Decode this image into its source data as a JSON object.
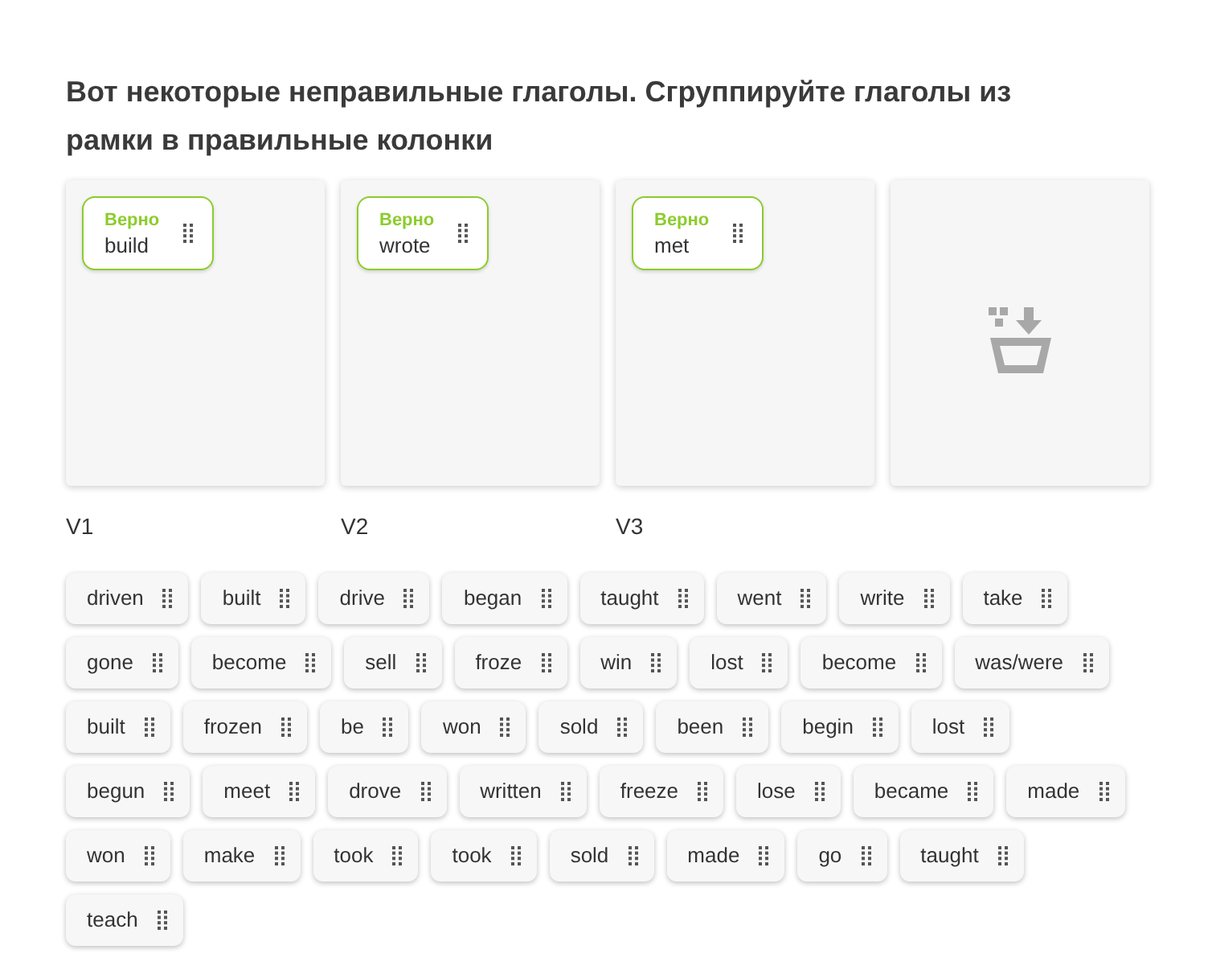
{
  "question": "Вот некоторые неправильные глаголы. Сгруппируйте глаголы из рамки в правильные колонки",
  "columns": [
    {
      "kind": "column",
      "label": "V1",
      "items": [
        {
          "verdict": "Верно",
          "correct": true,
          "word": "build"
        }
      ]
    },
    {
      "kind": "column",
      "label": "V2",
      "items": [
        {
          "verdict": "Верно",
          "correct": true,
          "word": "wrote"
        }
      ]
    },
    {
      "kind": "column",
      "label": "V3",
      "items": [
        {
          "verdict": "Верно",
          "correct": true,
          "word": "met"
        }
      ]
    },
    {
      "kind": "drop_target"
    }
  ],
  "word_bank": {
    "rows": [
      [
        "driven",
        "built",
        "drive",
        "began",
        "taught",
        "went",
        "write",
        "take"
      ],
      [
        "gone",
        "become",
        "sell",
        "froze",
        "win",
        "lost",
        "become",
        "was/were"
      ],
      [
        "built",
        "frozen",
        "be",
        "won",
        "sold",
        "been",
        "begin",
        "lost"
      ],
      [
        "begun",
        "meet",
        "drove",
        "written",
        "freeze",
        "lose",
        "became",
        "made"
      ],
      [
        "won",
        "make",
        "took",
        "took",
        "sold",
        "made",
        "go",
        "taught"
      ],
      [
        "teach"
      ]
    ]
  }
}
